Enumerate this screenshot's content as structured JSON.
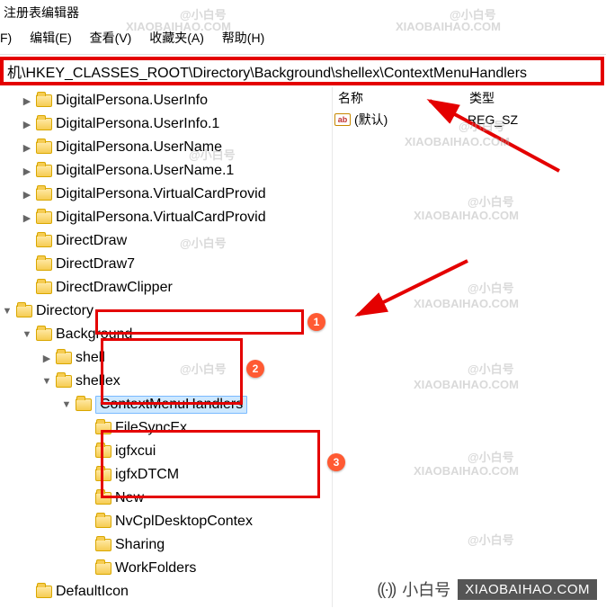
{
  "title": "注册表编辑器",
  "menu": {
    "file_frag": "F)",
    "edit": "编辑(E)",
    "view": "查看(V)",
    "favorites": "收藏夹(A)",
    "help": "帮助(H)"
  },
  "address": "机\\HKEY_CLASSES_ROOT\\Directory\\Background\\shellex\\ContextMenuHandlers",
  "tree": {
    "items": [
      {
        "ind": 1,
        "tw": "▶",
        "label": "DigitalPersona.UserInfo"
      },
      {
        "ind": 1,
        "tw": "▶",
        "label": "DigitalPersona.UserInfo.1"
      },
      {
        "ind": 1,
        "tw": "▶",
        "label": "DigitalPersona.UserName"
      },
      {
        "ind": 1,
        "tw": "▶",
        "label": "DigitalPersona.UserName.1"
      },
      {
        "ind": 1,
        "tw": "▶",
        "label": "DigitalPersona.VirtualCardProvid"
      },
      {
        "ind": 1,
        "tw": "▶",
        "label": "DigitalPersona.VirtualCardProvid"
      },
      {
        "ind": 1,
        "tw": "",
        "label": "DirectDraw"
      },
      {
        "ind": 1,
        "tw": "",
        "label": "DirectDraw7"
      },
      {
        "ind": 1,
        "tw": "",
        "label": "DirectDrawClipper"
      },
      {
        "ind": 0,
        "tw": "▼",
        "label": "Directory"
      },
      {
        "ind": 1,
        "tw": "▼",
        "label": "Background"
      },
      {
        "ind": 2,
        "tw": "▶",
        "label": "shell"
      },
      {
        "ind": 2,
        "tw": "▼",
        "label": "shellex"
      },
      {
        "ind": 3,
        "tw": "▼",
        "label": "ContextMenuHandlers",
        "sel": true
      },
      {
        "ind": 4,
        "tw": "",
        "label": "FileSyncEx"
      },
      {
        "ind": 4,
        "tw": "",
        "label": "igfxcui"
      },
      {
        "ind": 4,
        "tw": "",
        "label": "igfxDTCM"
      },
      {
        "ind": 4,
        "tw": "",
        "label": "New"
      },
      {
        "ind": 4,
        "tw": "",
        "label": "NvCplDesktopContex"
      },
      {
        "ind": 4,
        "tw": "",
        "label": "Sharing"
      },
      {
        "ind": 4,
        "tw": "",
        "label": "WorkFolders"
      },
      {
        "ind": 1,
        "tw": "",
        "label": "DefaultIcon"
      }
    ]
  },
  "list": {
    "headers": {
      "name": "名称",
      "type": "类型"
    },
    "rows": [
      {
        "name": "(默认)",
        "type": "REG_SZ"
      }
    ]
  },
  "badges": {
    "b1": "1",
    "b2": "2",
    "b3": "3"
  },
  "watermark": {
    "cn": "@小白号",
    "en": "XIAOBAIHAO.COM",
    "brand_cn": "小白号",
    "brand_en": "XIAOBAIHAO.COM"
  }
}
